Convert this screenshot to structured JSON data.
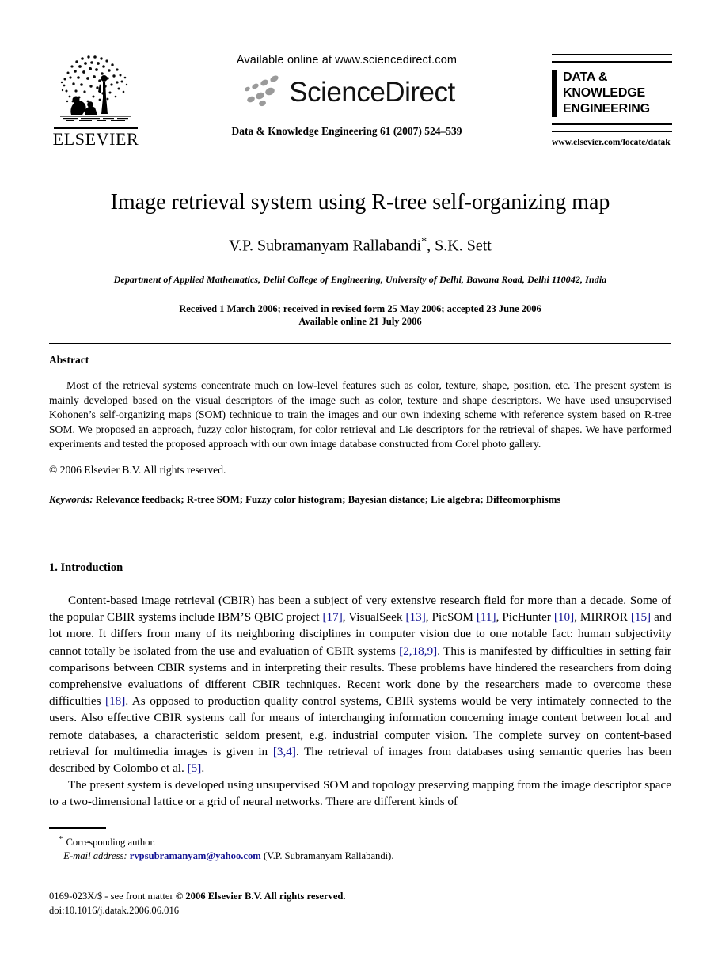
{
  "masthead": {
    "publisher_name": "ELSEVIER",
    "publisher_logo_icon": "elsevier-tree-icon",
    "available_online": "Available online at www.sciencedirect.com",
    "sciencedirect_wordmark": "ScienceDirect",
    "sciencedirect_logo_icon": "sciencedirect-dots-icon",
    "journal_citation": "Data & Knowledge Engineering 61 (2007) 524–539",
    "journal_logo": {
      "line1": "DATA &",
      "line2": "KNOWLEDGE",
      "line3": "ENGINEERING",
      "url": "www.elsevier.com/locate/datak"
    }
  },
  "article": {
    "title": "Image retrieval system using R-tree self-organizing map",
    "authors": "V.P. Subramanyam Rallabandi",
    "authors_suffix": ", S.K. Sett",
    "corresponding_marker": "*",
    "affiliation": "Department of Applied Mathematics, Delhi College of Engineering, University of Delhi, Bawana Road, Delhi 110042, India",
    "history_line1": "Received 1 March 2006; received in revised form 25 May 2006; accepted 23 June 2006",
    "history_line2": "Available online 21 July 2006"
  },
  "abstract": {
    "heading": "Abstract",
    "text": "Most of the retrieval systems concentrate much on low-level features such as color, texture, shape, position, etc. The present system is mainly developed based on the visual descriptors of the image such as color, texture and shape descriptors. We have used unsupervised Kohonen’s self-organizing maps (SOM) technique to train the images and our own indexing scheme with reference system based on R-tree SOM. We proposed an approach, fuzzy color histogram, for color retrieval and Lie descriptors for the retrieval of shapes. We have performed experiments and tested the proposed approach with our own image database constructed from Corel photo gallery.",
    "copyright": "© 2006 Elsevier B.V. All rights reserved.",
    "keywords_label": "Keywords:",
    "keywords_list": "Relevance feedback; R-tree SOM; Fuzzy color histogram; Bayesian distance; Lie algebra; Diffeomorphisms"
  },
  "introduction": {
    "heading": "1. Introduction",
    "paragraph1": {
      "part1": "Content-based image retrieval (CBIR) has been a subject of very extensive research field for more than a decade. Some of the popular CBIR systems include IBM’S QBIC project ",
      "ref1": "[17]",
      "part2": ", VisualSeek ",
      "ref2": "[13]",
      "part3": ", PicSOM ",
      "ref3": "[11]",
      "part4": ", PicHunter ",
      "ref4": "[10]",
      "part5": ", MIRROR ",
      "ref5": "[15]",
      "part6": " and lot more. It differs from many of its neighboring disciplines in computer vision due to one notable fact: human subjectivity cannot totally be isolated from the use and evaluation of CBIR systems ",
      "ref6": "[2,18,9]",
      "part7": ". This is manifested by difficulties in setting fair comparisons between CBIR systems and in interpreting their results. These problems have hindered the researchers from doing comprehensive evaluations of different CBIR techniques. Recent work done by the researchers made to overcome these difficulties ",
      "ref7": "[18]",
      "part8": ". As opposed to production quality control systems, CBIR systems would be very intimately connected to the users. Also effective CBIR systems call for means of interchanging information concerning image content between local and remote databases, a characteristic seldom present, e.g. industrial computer vision. The complete survey on content-based retrieval for multimedia images is given in ",
      "ref8": "[3,4]",
      "part9": ". The retrieval of images from databases using semantic queries has been described by Colombo et al. ",
      "ref9": "[5]",
      "part10": "."
    },
    "paragraph2": "The present system is developed using unsupervised SOM and topology preserving mapping from the image descriptor space to a two-dimensional lattice or a grid of neural networks. There are different kinds of"
  },
  "footnotes": {
    "corresponding_marker": "*",
    "corresponding_author": "Corresponding author.",
    "email_label": "E-mail address:",
    "email_address": "rvpsubramanyam@yahoo.com",
    "email_owner": "(V.P. Subramanyam Rallabandi)."
  },
  "imprint": {
    "issn_line_plain_1": "0169-023X/$ - see front matter ",
    "issn_line_bold": "© 2006 Elsevier B.V. All rights reserved.",
    "doi_line": "doi:10.1016/j.datak.2006.06.016"
  },
  "colors": {
    "link_blue": "#141494",
    "text_black": "#000000",
    "sd_dot_gray": "#9a9a9a",
    "page_background": "#ffffff"
  }
}
